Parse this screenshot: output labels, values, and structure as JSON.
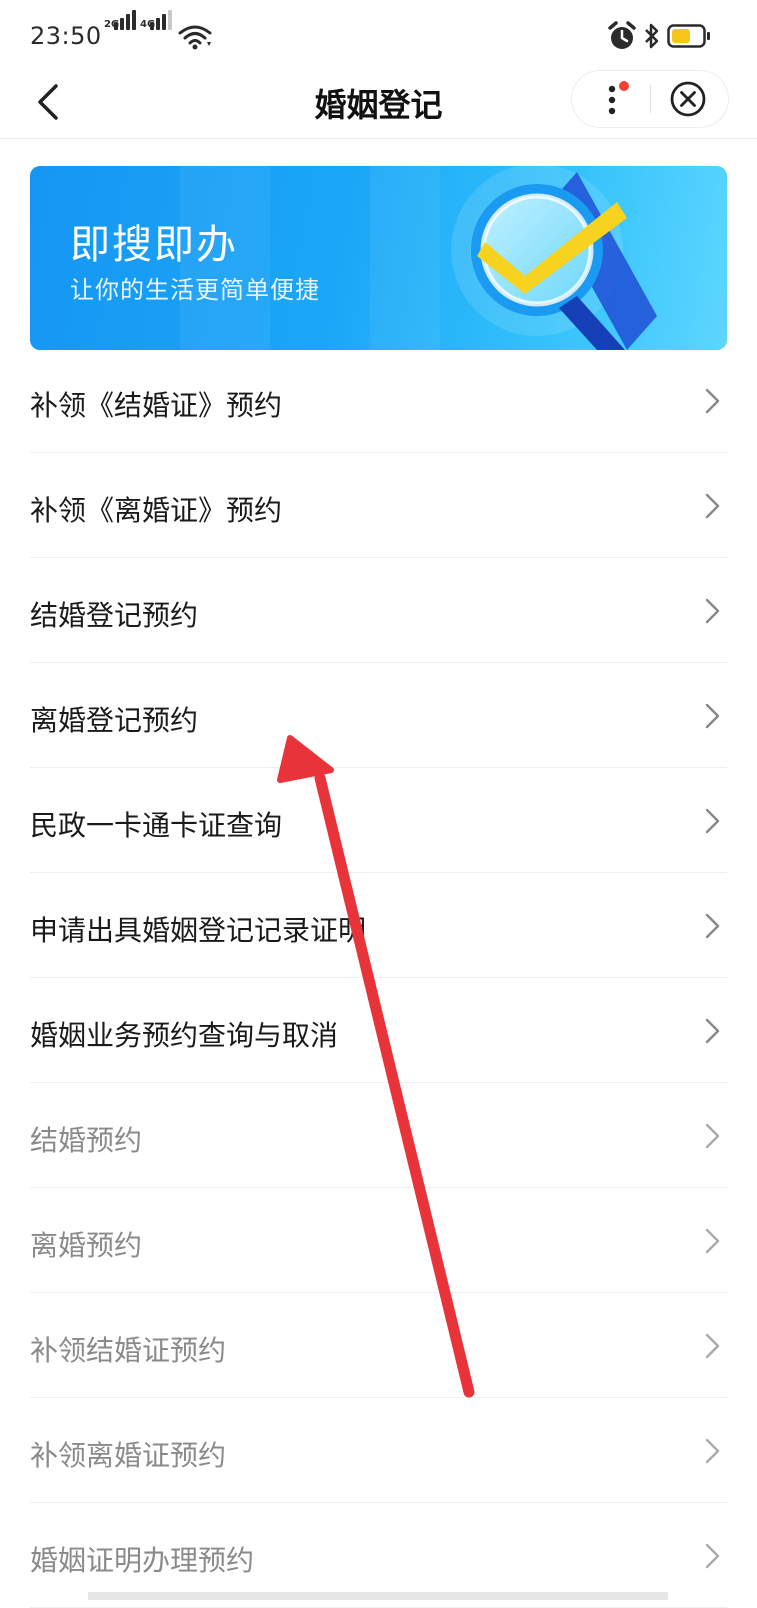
{
  "status_bar": {
    "time": "23:50",
    "network_1": "2G",
    "network_2": "4G",
    "icons": [
      "signal-2g-icon",
      "signal-4g-icon",
      "wifi-icon",
      "alarm-icon",
      "bluetooth-icon",
      "battery-icon"
    ],
    "battery_color": "#f5c518"
  },
  "nav": {
    "title": "婚姻登记",
    "back_icon": "chevron-left-icon",
    "more_icon": "more-vertical-icon",
    "close_icon": "close-circle-icon",
    "badge_color": "#f04134"
  },
  "banner": {
    "title": "即搜即办",
    "subtitle": "让你的生活更简单便捷",
    "colors": {
      "start": "#1596f3",
      "end": "#5dd6ff",
      "check": "#f7d21e"
    }
  },
  "menu": {
    "items": [
      {
        "label": "补领《结婚证》预约",
        "muted": false
      },
      {
        "label": "补领《离婚证》预约",
        "muted": false
      },
      {
        "label": "结婚登记预约",
        "muted": false
      },
      {
        "label": "离婚登记预约",
        "muted": false
      },
      {
        "label": "民政一卡通卡证查询",
        "muted": false
      },
      {
        "label": "申请出具婚姻登记记录证明",
        "muted": false
      },
      {
        "label": "婚姻业务预约查询与取消",
        "muted": false
      },
      {
        "label": "结婚预约",
        "muted": true
      },
      {
        "label": "离婚预约",
        "muted": true
      },
      {
        "label": "补领结婚证预约",
        "muted": true
      },
      {
        "label": "补领离婚证预约",
        "muted": true
      },
      {
        "label": "婚姻证明办理预约",
        "muted": true
      }
    ]
  },
  "annotation": {
    "arrow_color": "#e8333a",
    "points_to": "离婚登记预约"
  }
}
